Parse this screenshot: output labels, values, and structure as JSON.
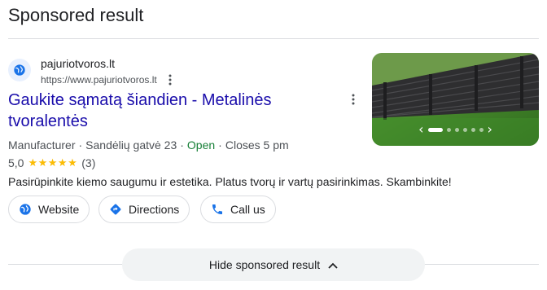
{
  "section": {
    "heading": "Sponsored result"
  },
  "ad": {
    "site_name": "pajuriotvoros.lt",
    "url": "https://www.pajuriotvoros.lt",
    "title": "Gaukite sąmatą šiandien - Metalinės tvoralentės",
    "category": "Manufacturer",
    "address": "Sandėlių gatvė 23",
    "status": "Open",
    "hours": "Closes 5 pm",
    "rating_value": "5,0",
    "rating_stars": 5,
    "rating_count": "(3)",
    "description": "Pasirūpinkite kiemo saugumu ir estetika. Platus tvorų ir vartų pasirinkimas. Skambinkite!",
    "carousel_total": 6,
    "carousel_active": 1
  },
  "actions": {
    "website": "Website",
    "directions": "Directions",
    "call": "Call us"
  },
  "footer": {
    "hide_label": "Hide sponsored result"
  },
  "colors": {
    "link": "#1a0dab",
    "open": "#188038",
    "star": "#fbbc04",
    "icon_blue": "#1a73e8"
  }
}
